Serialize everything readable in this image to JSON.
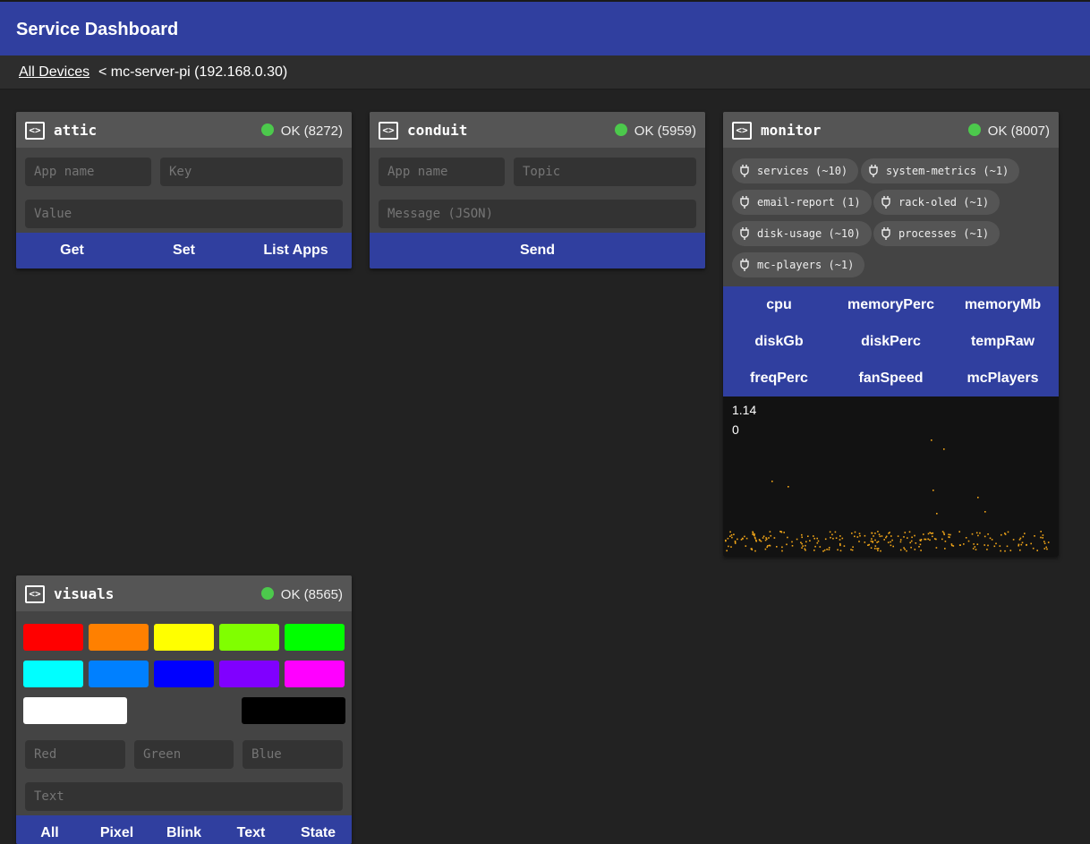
{
  "app": {
    "title": "Service Dashboard"
  },
  "breadcrumb": {
    "link": "All Devices",
    "current": "< mc-server-pi (192.168.0.30)"
  },
  "colors": {
    "primary": "#303f9f",
    "ok": "#4cc94c",
    "plot_points": "#f2a618"
  },
  "attic": {
    "name": "attic",
    "status": "OK (8272)",
    "icon": "code-icon",
    "app_placeholder": "App name",
    "key_placeholder": "Key",
    "value_placeholder": "Value",
    "buttons": [
      "Get",
      "Set",
      "List Apps"
    ]
  },
  "conduit": {
    "name": "conduit",
    "status": "OK (5959)",
    "icon": "code-icon",
    "app_placeholder": "App name",
    "topic_placeholder": "Topic",
    "message_placeholder": "Message (JSON)",
    "send_label": "Send"
  },
  "monitor": {
    "name": "monitor",
    "status": "OK (8007)",
    "icon": "code-icon",
    "chips": [
      "services (~10)",
      "system-metrics (~1)",
      "email-report (1)",
      "rack-oled (~1)",
      "disk-usage (~10)",
      "processes (~1)",
      "mc-players (~1)"
    ],
    "metrics": [
      "cpu",
      "memoryPerc",
      "memoryMb",
      "diskGb",
      "diskPerc",
      "tempRaw",
      "freqPerc",
      "fanSpeed",
      "mcPlayers"
    ],
    "plot_max": "1.14",
    "plot_min": "0"
  },
  "visuals": {
    "name": "visuals",
    "status": "OK (8565)",
    "icon": "code-icon",
    "swatches": [
      "#ff0000",
      "#ff8000",
      "#ffff00",
      "#80ff00",
      "#00ff00",
      "#00ffff",
      "#0080ff",
      "#0000ff",
      "#8000ff",
      "#ff00ff"
    ],
    "wide_swatches": [
      "#ffffff",
      "#444444",
      "#000000"
    ],
    "red_placeholder": "Red",
    "green_placeholder": "Green",
    "blue_placeholder": "Blue",
    "text_placeholder": "Text",
    "buttons": [
      "All",
      "Pixel",
      "Blink",
      "Text",
      "State"
    ]
  }
}
